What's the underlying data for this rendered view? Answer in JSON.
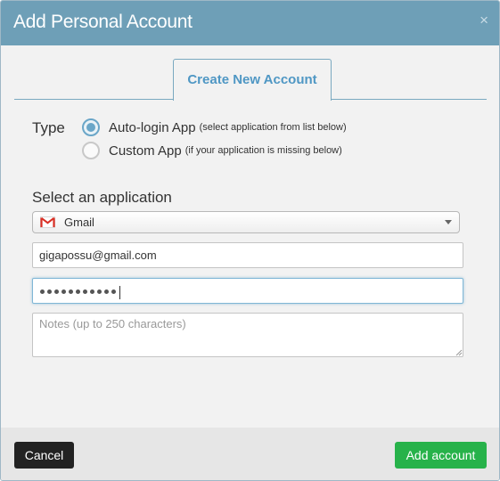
{
  "dialog": {
    "title": "Add Personal Account",
    "close_symbol": "×"
  },
  "tabs": [
    {
      "label": "Create New Account",
      "active": true
    }
  ],
  "type_section": {
    "label": "Type",
    "options": [
      {
        "label": "Auto-login App",
        "hint": "(select application from list below)",
        "selected": true
      },
      {
        "label": "Custom App",
        "hint": "(if your application is missing below)",
        "selected": false
      }
    ]
  },
  "application": {
    "label": "Select an application",
    "selected": "Gmail",
    "icon": "gmail-icon"
  },
  "fields": {
    "email_value": "gigapossu@gmail.com",
    "password_masked_length": 11,
    "notes_placeholder": "Notes (up to 250 characters)"
  },
  "footer": {
    "cancel_label": "Cancel",
    "add_label": "Add account"
  },
  "colors": {
    "titlebar": "#6e9fb7",
    "tab_text": "#4f97c4",
    "add_button": "#27b24a",
    "cancel_button": "#222222"
  }
}
